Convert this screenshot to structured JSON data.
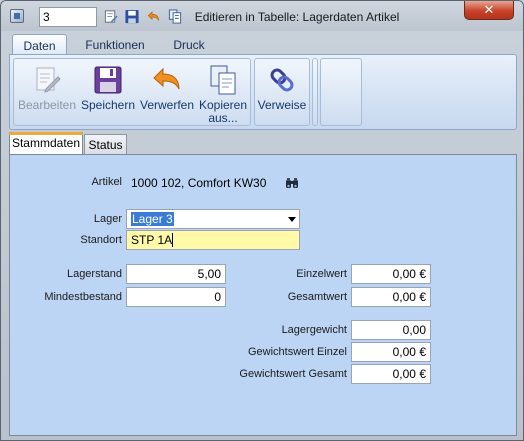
{
  "window": {
    "record_number": "3",
    "title": "Editieren in Tabelle: Lagerdaten Artikel"
  },
  "quick_access": {
    "icons": [
      "edit-icon",
      "save-icon",
      "undo-icon",
      "copy-icon"
    ]
  },
  "ribbon": {
    "tabs": [
      {
        "label": "Daten",
        "active": true
      },
      {
        "label": "Funktionen",
        "active": false
      },
      {
        "label": "Druck",
        "active": false
      }
    ],
    "buttons": {
      "edit": {
        "label": "Bearbeiten",
        "enabled": false
      },
      "save": {
        "label": "Speichern",
        "enabled": true
      },
      "discard": {
        "label": "Verwerfen",
        "enabled": true
      },
      "copy_from": {
        "label_line1": "Kopieren",
        "label_line2": "aus...",
        "enabled": true
      },
      "references": {
        "label": "Verweise",
        "enabled": true
      }
    }
  },
  "sub_tabs": [
    {
      "label": "Stammdaten",
      "active": true
    },
    {
      "label": "Status",
      "active": false
    }
  ],
  "form": {
    "artikel": {
      "label": "Artikel",
      "value": "1000 102, Comfort KW30"
    },
    "lager": {
      "label": "Lager",
      "value": "Lager 3"
    },
    "standort": {
      "label": "Standort",
      "value": "STP 1A"
    },
    "lagerstand": {
      "label": "Lagerstand",
      "value": "5,00"
    },
    "mindestbestand": {
      "label": "Mindestbestand",
      "value": "0"
    },
    "einzelwert": {
      "label": "Einzelwert",
      "value": "0,00 €"
    },
    "gesamtwert": {
      "label": "Gesamtwert",
      "value": "0,00 €"
    },
    "lagergewicht": {
      "label": "Lagergewicht",
      "value": "0,00"
    },
    "gewichtswert_einzel": {
      "label": "Gewichtswert Einzel",
      "value": "0,00 €"
    },
    "gewichtswert_gesamt": {
      "label": "Gewichtswert Gesamt",
      "value": "0,00 €"
    }
  },
  "colors": {
    "panel_background": "#bdd5f5",
    "highlight_field": "#fff9a8",
    "selection": "#3a7bd5",
    "close_button": "#c7432a"
  }
}
